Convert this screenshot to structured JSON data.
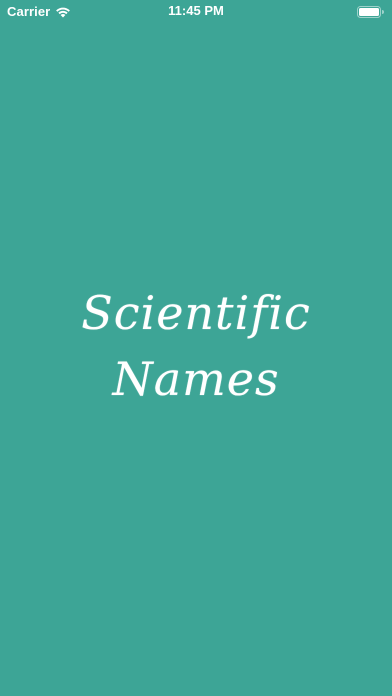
{
  "status_bar": {
    "carrier": "Carrier",
    "time": "11:45 PM",
    "wifi_icon": "wifi-icon",
    "battery_icon": "battery-icon"
  },
  "splash": {
    "title_line1": "Scientific",
    "title_line2": "Names"
  },
  "colors": {
    "background": "#3da596",
    "text": "#ffffff"
  }
}
